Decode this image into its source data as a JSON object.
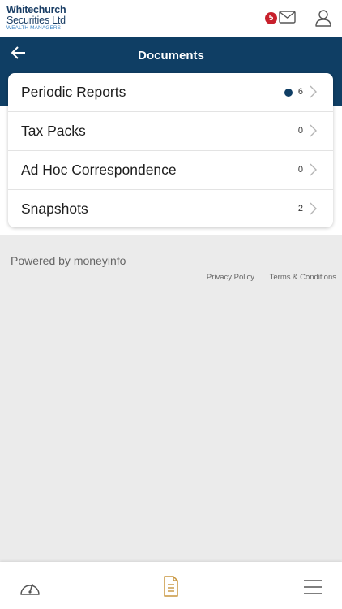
{
  "brand": {
    "line1": "Whitechurch",
    "line2": "Securities Ltd",
    "line3": "WEALTH MANAGERS"
  },
  "header": {
    "message_count": "5",
    "title": "Documents"
  },
  "documents": [
    {
      "label": "Periodic Reports",
      "count": "6",
      "unread": true
    },
    {
      "label": "Tax Packs",
      "count": "0",
      "unread": false
    },
    {
      "label": "Ad Hoc Correspondence",
      "count": "0",
      "unread": false
    },
    {
      "label": "Snapshots",
      "count": "2",
      "unread": false
    }
  ],
  "footer": {
    "powered_by": "Powered by moneyinfo",
    "privacy": "Privacy Policy",
    "terms": "Terms & Conditions"
  },
  "icons": {
    "back": "arrow-left-icon",
    "mail": "envelope-icon",
    "user": "user-icon",
    "chevron": "chevron-right-icon",
    "dashboard": "gauge-icon",
    "documents": "document-icon",
    "menu": "hamburger-icon"
  },
  "colors": {
    "navy": "#0f3e64",
    "badge_red": "#c8202c",
    "documents_tab_accent": "#c8953e",
    "background": "#ebebeb"
  }
}
